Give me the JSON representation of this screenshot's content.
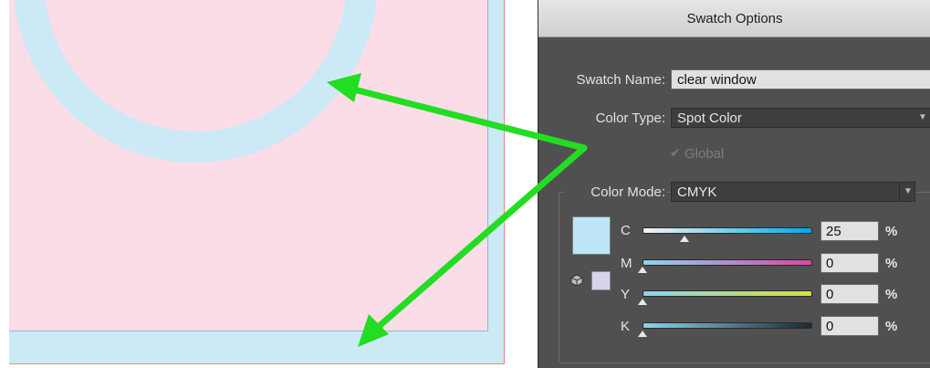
{
  "dialog": {
    "title": "Swatch Options",
    "swatch_name_label": "Swatch Name:",
    "swatch_name_value": "clear window",
    "color_type_label": "Color Type:",
    "color_type_value": "Spot Color",
    "global_label": "Global",
    "global_checked": true,
    "color_mode_label": "Color Mode:",
    "color_mode_value": "CMYK",
    "swatch_color": "#bfe6f8",
    "channels": [
      {
        "label": "C",
        "value": "25",
        "unit": "%",
        "level": 0.25
      },
      {
        "label": "M",
        "value": "0",
        "unit": "%",
        "level": 0
      },
      {
        "label": "Y",
        "value": "0",
        "unit": "%",
        "level": 0
      },
      {
        "label": "K",
        "value": "0",
        "unit": "%",
        "level": 0
      }
    ]
  },
  "artwork": {
    "fill_color": "#fbdde8",
    "window_color": "#cce9f6",
    "annotation_color": "#22dd22"
  },
  "icons": {
    "color_gamut": "cube-icon",
    "global_check": "check-icon",
    "dropdown": "chevron-down-icon"
  }
}
